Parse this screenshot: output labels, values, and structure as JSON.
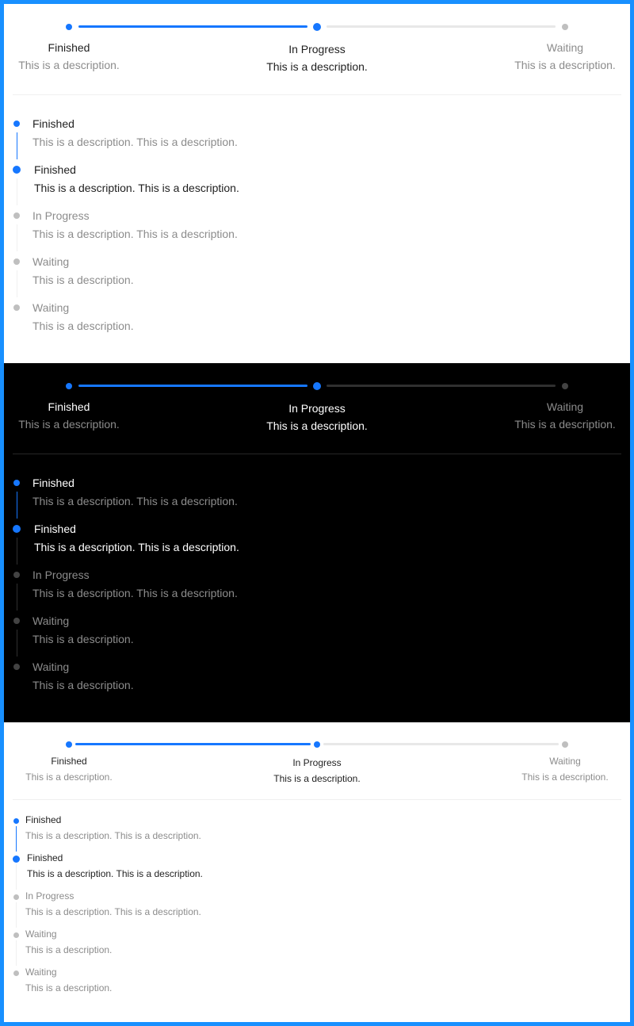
{
  "colors": {
    "accent": "#1677ff",
    "border": "#1890ff",
    "light_text": "#1f1f1f",
    "light_muted": "#8c8c8c",
    "light_track": "#e8e8e8",
    "light_gray_dot": "#bfbfbf",
    "dark_text": "#ffffff",
    "dark_muted": "#8c8c8c",
    "dark_track": "#303030",
    "dark_gray_dot": "#434343"
  },
  "sections": [
    {
      "theme": "light",
      "horizontal": [
        {
          "title": "Finished",
          "desc": "This is a description.",
          "status": "finish"
        },
        {
          "title": "In Progress",
          "desc": "This is a description.",
          "status": "process"
        },
        {
          "title": "Waiting",
          "desc": "This is a description.",
          "status": "wait"
        }
      ],
      "vertical": [
        {
          "title": "Finished",
          "desc": "This is a description. This is a description.",
          "status": "finish"
        },
        {
          "title": "Finished",
          "desc": "This is a description. This is a description.",
          "status": "process"
        },
        {
          "title": "In Progress",
          "desc": "This is a description. This is a description.",
          "status": "wait"
        },
        {
          "title": "Waiting",
          "desc": "This is a description.",
          "status": "wait"
        },
        {
          "title": "Waiting",
          "desc": "This is a description.",
          "status": "wait"
        }
      ]
    },
    {
      "theme": "dark",
      "horizontal": [
        {
          "title": "Finished",
          "desc": "This is a description.",
          "status": "finish"
        },
        {
          "title": "In Progress",
          "desc": "This is a description.",
          "status": "process"
        },
        {
          "title": "Waiting",
          "desc": "This is a description.",
          "status": "wait"
        }
      ],
      "vertical": [
        {
          "title": "Finished",
          "desc": "This is a description. This is a description.",
          "status": "finish"
        },
        {
          "title": "Finished",
          "desc": "This is a description. This is a description.",
          "status": "process"
        },
        {
          "title": "In Progress",
          "desc": "This is a description. This is a description.",
          "status": "wait"
        },
        {
          "title": "Waiting",
          "desc": "This is a description.",
          "status": "wait"
        },
        {
          "title": "Waiting",
          "desc": "This is a description.",
          "status": "wait"
        }
      ]
    },
    {
      "theme": "light-small",
      "horizontal": [
        {
          "title": "Finished",
          "desc": "This is a description.",
          "status": "finish"
        },
        {
          "title": "In Progress",
          "desc": "This is a description.",
          "status": "process"
        },
        {
          "title": "Waiting",
          "desc": "This is a description.",
          "status": "wait"
        }
      ],
      "vertical": [
        {
          "title": "Finished",
          "desc": "This is a description. This is a description.",
          "status": "finish"
        },
        {
          "title": "Finished",
          "desc": "This is a description. This is a description.",
          "status": "process"
        },
        {
          "title": "In Progress",
          "desc": "This is a description. This is a description.",
          "status": "wait"
        },
        {
          "title": "Waiting",
          "desc": "This is a description.",
          "status": "wait"
        },
        {
          "title": "Waiting",
          "desc": "This is a description.",
          "status": "wait"
        }
      ]
    }
  ]
}
